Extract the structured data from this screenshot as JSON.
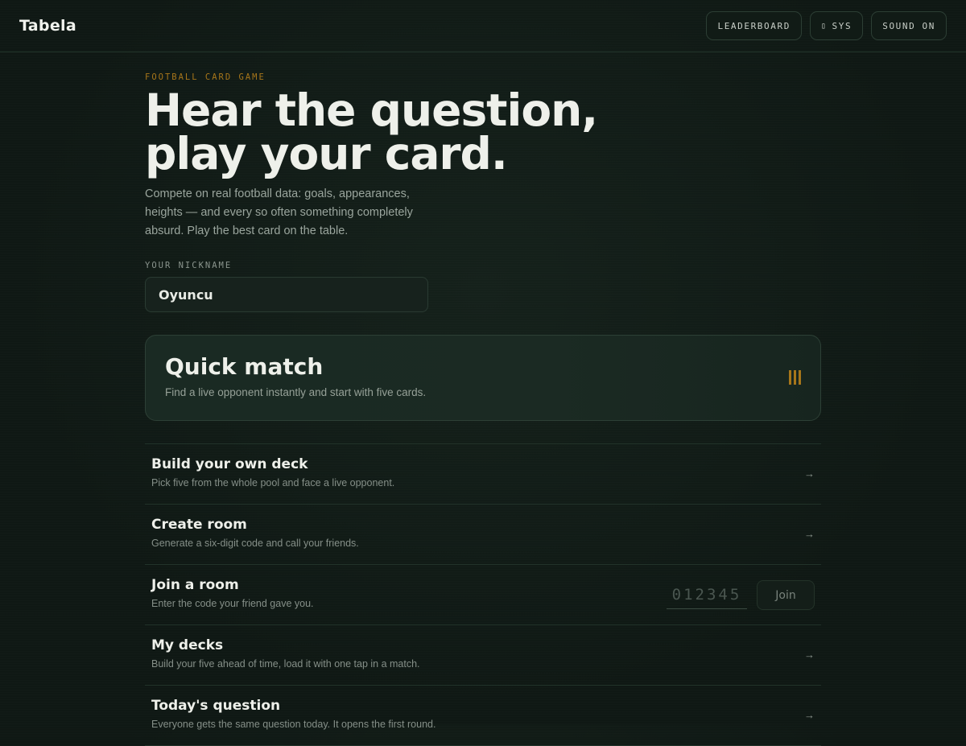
{
  "header": {
    "brand": "Tabela",
    "leaderboard_label": "LEADERBOARD",
    "sys_label": "SYS",
    "sound_label": "SOUND ON"
  },
  "hero": {
    "eyebrow": "FOOTBALL CARD GAME",
    "headline_line1": "Hear the question,",
    "headline_line2": "play your card.",
    "description": "Compete on real football data: goals, appearances, heights — and every so often something completely absurd. Play the best card on the table."
  },
  "nickname": {
    "label": "YOUR NICKNAME",
    "value": "Oyuncu"
  },
  "quick_match": {
    "title": "Quick match",
    "subtitle": "Find a live opponent instantly and start with five cards.",
    "accent": "#a7761a"
  },
  "options": [
    {
      "title": "Build your own deck",
      "subtitle": "Pick five from the whole pool and face a live opponent.",
      "arrow": "→"
    },
    {
      "title": "Create room",
      "subtitle": "Generate a six-digit code and call your friends.",
      "arrow": "→"
    },
    {
      "title": "Join a room",
      "subtitle": "Enter the code your friend gave you.",
      "code_placeholder": "012345",
      "join_label": "Join"
    },
    {
      "title": "My decks",
      "subtitle": "Build your five ahead of time, load it with one tap in a match.",
      "arrow": "→"
    },
    {
      "title": "Today's question",
      "subtitle": "Everyone gets the same question today. It opens the first round.",
      "arrow": "→"
    }
  ]
}
